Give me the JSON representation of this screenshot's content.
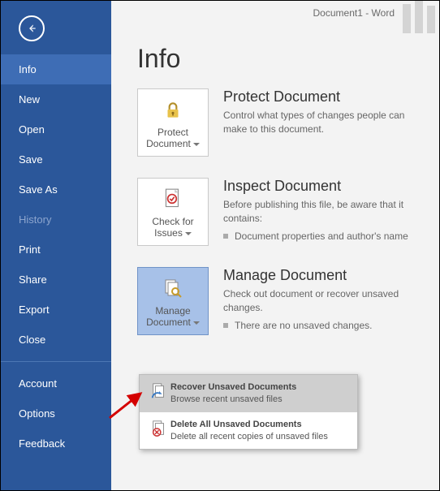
{
  "window_title": "Document1 - Word",
  "page_title": "Info",
  "sidebar": [
    "Info",
    "New",
    "Open",
    "Save",
    "Save As",
    "History",
    "Print",
    "Share",
    "Export",
    "Close",
    "Account",
    "Options",
    "Feedback"
  ],
  "sections": {
    "protect": {
      "button": "Protect Document",
      "heading": "Protect Document",
      "desc": "Control what types of changes people can make to this document."
    },
    "inspect": {
      "button": "Check for Issues",
      "heading": "Inspect Document",
      "desc": "Before publishing this file, be aware that it contains:",
      "bullet": "Document properties and author's name"
    },
    "manage": {
      "button": "Manage Document",
      "heading": "Manage Document",
      "desc": "Check out document or recover unsaved changes.",
      "bullet": "There are no unsaved changes."
    }
  },
  "popup": {
    "recover": {
      "title": "Recover Unsaved Documents",
      "desc": "Browse recent unsaved files"
    },
    "delete": {
      "title": "Delete All Unsaved Documents",
      "desc": "Delete all recent copies of unsaved files"
    }
  }
}
